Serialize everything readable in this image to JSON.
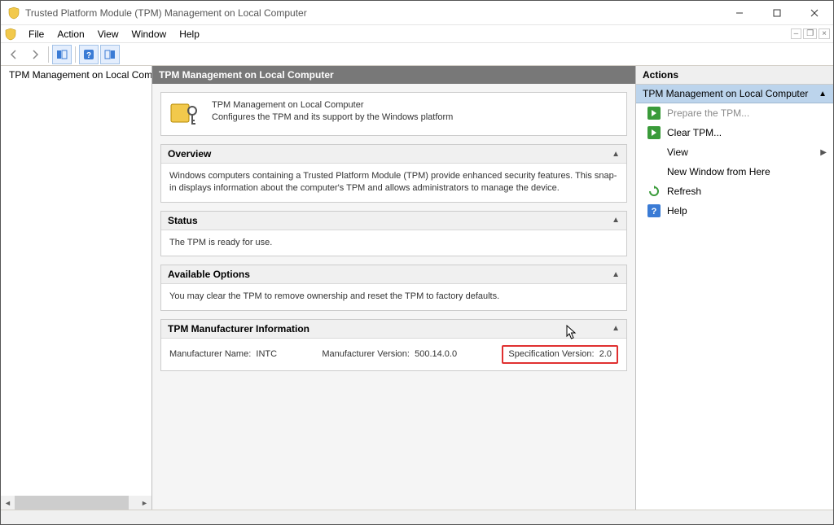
{
  "window": {
    "title": "Trusted Platform Module (TPM) Management on Local Computer"
  },
  "menu": {
    "file": "File",
    "action": "Action",
    "view": "View",
    "window": "Window",
    "help": "Help"
  },
  "tree": {
    "root": "TPM Management on Local Comp"
  },
  "center": {
    "header": "TPM Management on Local Computer",
    "intro_title": "TPM Management on Local Computer",
    "intro_desc": "Configures the TPM and its support by the Windows platform",
    "overview": {
      "title": "Overview",
      "body": "Windows computers containing a Trusted Platform Module (TPM) provide enhanced security features. This snap-in displays information about the computer's TPM and allows administrators to manage the device."
    },
    "status": {
      "title": "Status",
      "body": "The TPM is ready for use."
    },
    "options": {
      "title": "Available Options",
      "body": "You may clear the TPM to remove ownership and reset the TPM to factory defaults."
    },
    "mfr": {
      "title": "TPM Manufacturer Information",
      "name_label": "Manufacturer Name:",
      "name_value": "INTC",
      "ver_label": "Manufacturer Version:",
      "ver_value": "500.14.0.0",
      "spec_label": "Specification Version:",
      "spec_value": "2.0"
    }
  },
  "actions": {
    "header": "Actions",
    "context": "TPM Management on Local Computer",
    "prepare": "Prepare the TPM...",
    "clear": "Clear TPM...",
    "view": "View",
    "newwin": "New Window from Here",
    "refresh": "Refresh",
    "help": "Help"
  }
}
